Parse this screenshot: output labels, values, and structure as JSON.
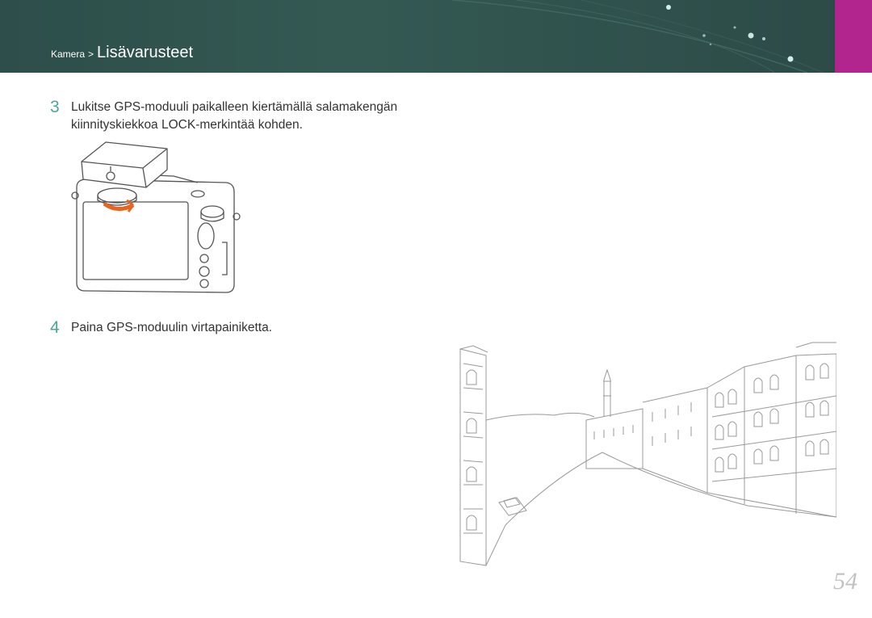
{
  "header": {
    "breadcrumb_parent": "Kamera",
    "breadcrumb_separator": ">",
    "breadcrumb_current": "Lisävarusteet",
    "accent_color": "#b3258e",
    "bar_color": "#2f4f4c"
  },
  "steps": [
    {
      "number": "3",
      "lines": [
        "Lukitse GPS-moduuli paikalleen kiertämällä salamakengän",
        "kiinnityskiekkoa LOCK-merkintää kohden."
      ]
    },
    {
      "number": "4",
      "lines": [
        "Paina GPS-moduulin virtapainiketta."
      ]
    }
  ],
  "illustrations": {
    "camera": "camera-with-gps-module-illustration",
    "rotation_arrow_color": "#e8641e",
    "city": "city-canal-line-drawing"
  },
  "page_number": "54"
}
